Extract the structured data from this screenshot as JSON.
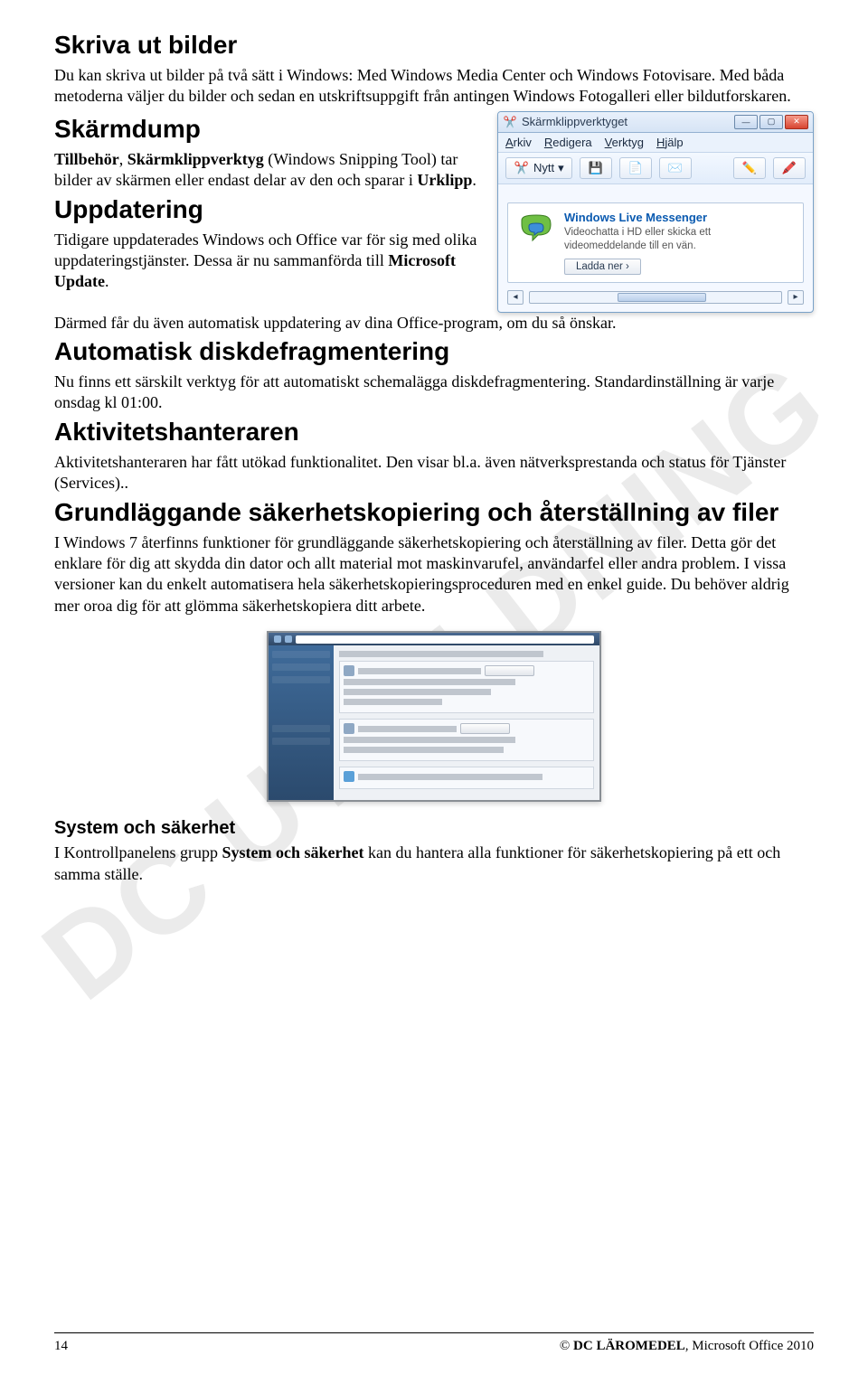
{
  "watermark": "DC UTBILDNING",
  "sections": {
    "skriva": {
      "h": "Skriva ut bilder",
      "p": "Du kan skriva ut bilder på två sätt i Windows: Med Windows Media Center och Windows Fotovisare. Med båda metoderna väljer du bilder och sedan en utskriftsuppgift från antingen Windows Fotogalleri eller bildutforskaren."
    },
    "skarmdump": {
      "h": "Skärmdump",
      "p1a": "Tillbehör",
      "p1b": ", ",
      "p1c": "Skärmklippverktyg",
      "p1d": " (Windows Snipping Tool) tar bilder av skärmen eller endast delar av den och sparar i ",
      "p1e": "Urklipp",
      "p1f": "."
    },
    "uppdatering": {
      "h": "Uppdatering",
      "p_a": "Tidigare uppdaterades Windows och Office var för sig med olika uppdateringstjänster. Dessa är nu sammanförda till ",
      "p_b": "Microsoft Update",
      "p_c": ".",
      "p2": "Därmed får du även automatisk uppdatering av dina Office-program, om du så önskar."
    },
    "defrag": {
      "h": "Automatisk diskdefragmentering",
      "p": "Nu finns ett särskilt verktyg för att automatiskt schemalägga diskdefragmentering. Standardinställning är varje onsdag kl 01:00."
    },
    "aktivitet": {
      "h": "Aktivitetshanteraren",
      "p": "Aktivitetshanteraren har fått utökad funktionalitet. Den visar bl.a. även nätverksprestanda och status för Tjänster (Services).."
    },
    "backup": {
      "h": "Grundläggande säkerhetskopiering och återställning av filer",
      "p": "I Windows 7 återfinns funktioner för grundläggande säkerhetskopiering och återställning av filer. Detta gör det enklare för dig att skydda din dator och allt material mot maskinvarufel, användarfel eller andra problem. I vissa versioner kan du enkelt automatisera hela säkerhetskopieringsproceduren med en enkel guide. Du behöver aldrig mer oroa dig för att glömma säkerhetskopiera ditt arbete."
    },
    "system": {
      "h": "System och säkerhet",
      "p_a": "I Kontrollpanelens grupp ",
      "p_b": "System och säkerhet",
      "p_c": " kan du hantera alla funktioner för säkerhetskopiering på ett och samma ställe."
    }
  },
  "snip": {
    "title": "Skärmklippverktyget",
    "menu": {
      "a": "Arkiv",
      "r": "Redigera",
      "v": "Verktyg",
      "h": "Hjälp"
    },
    "nytt": "Nytt",
    "popup_title": "Windows Live Messenger",
    "popup_text": "Videochatta i HD eller skicka ett videomeddelande till en vän.",
    "popup_btn": "Ladda ner"
  },
  "footer": {
    "page": "14",
    "copy_a": "© ",
    "copy_b": "DC LÄROMEDEL",
    "copy_c": ", Microsoft Office 2010"
  }
}
